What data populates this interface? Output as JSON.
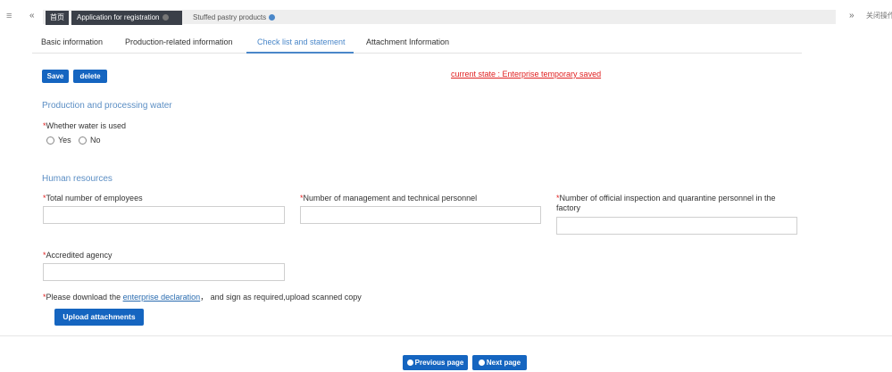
{
  "topbar": {
    "menu_icon": "menu-icon",
    "prev_icon": "double-chevron-left-icon",
    "next_icon": "double-chevron-right-icon",
    "tabs": [
      {
        "label": "首页"
      },
      {
        "label": "Application for registration"
      },
      {
        "label": "Stuffed pastry products"
      }
    ],
    "close_ops_label": "关闭操作"
  },
  "subtabs": [
    {
      "label": "Basic information"
    },
    {
      "label": "Production-related information"
    },
    {
      "label": "Check list and statement"
    },
    {
      "label": "Attachment Information"
    }
  ],
  "actions": {
    "save_label": "Save",
    "delete_label": "delete",
    "current_state": "current state : Enterprise temporary saved"
  },
  "water": {
    "section_title": "Production and processing water",
    "question": "Whether water is used",
    "options": [
      "Yes",
      "No"
    ]
  },
  "human": {
    "section_title": "Human resources",
    "total_employees_label": "Total number of employees",
    "mgmt_label": "Number of management and technical personnel",
    "inspection_label": "Number of official inspection and quarantine personnel in the factory",
    "agency_label": "Accredited agency"
  },
  "download": {
    "prefix": "Please download the ",
    "link": "enterprise declaration",
    "suffix": "， and sign as required,upload scanned copy",
    "upload_label": "Upload attachments"
  },
  "pager": {
    "prev_label": "Previous page",
    "next_label": "Next page"
  },
  "colors": {
    "accent": "#1565c0",
    "tab_dark": "#3a3f48",
    "required": "#e02020",
    "section": "#5b8ec4"
  }
}
